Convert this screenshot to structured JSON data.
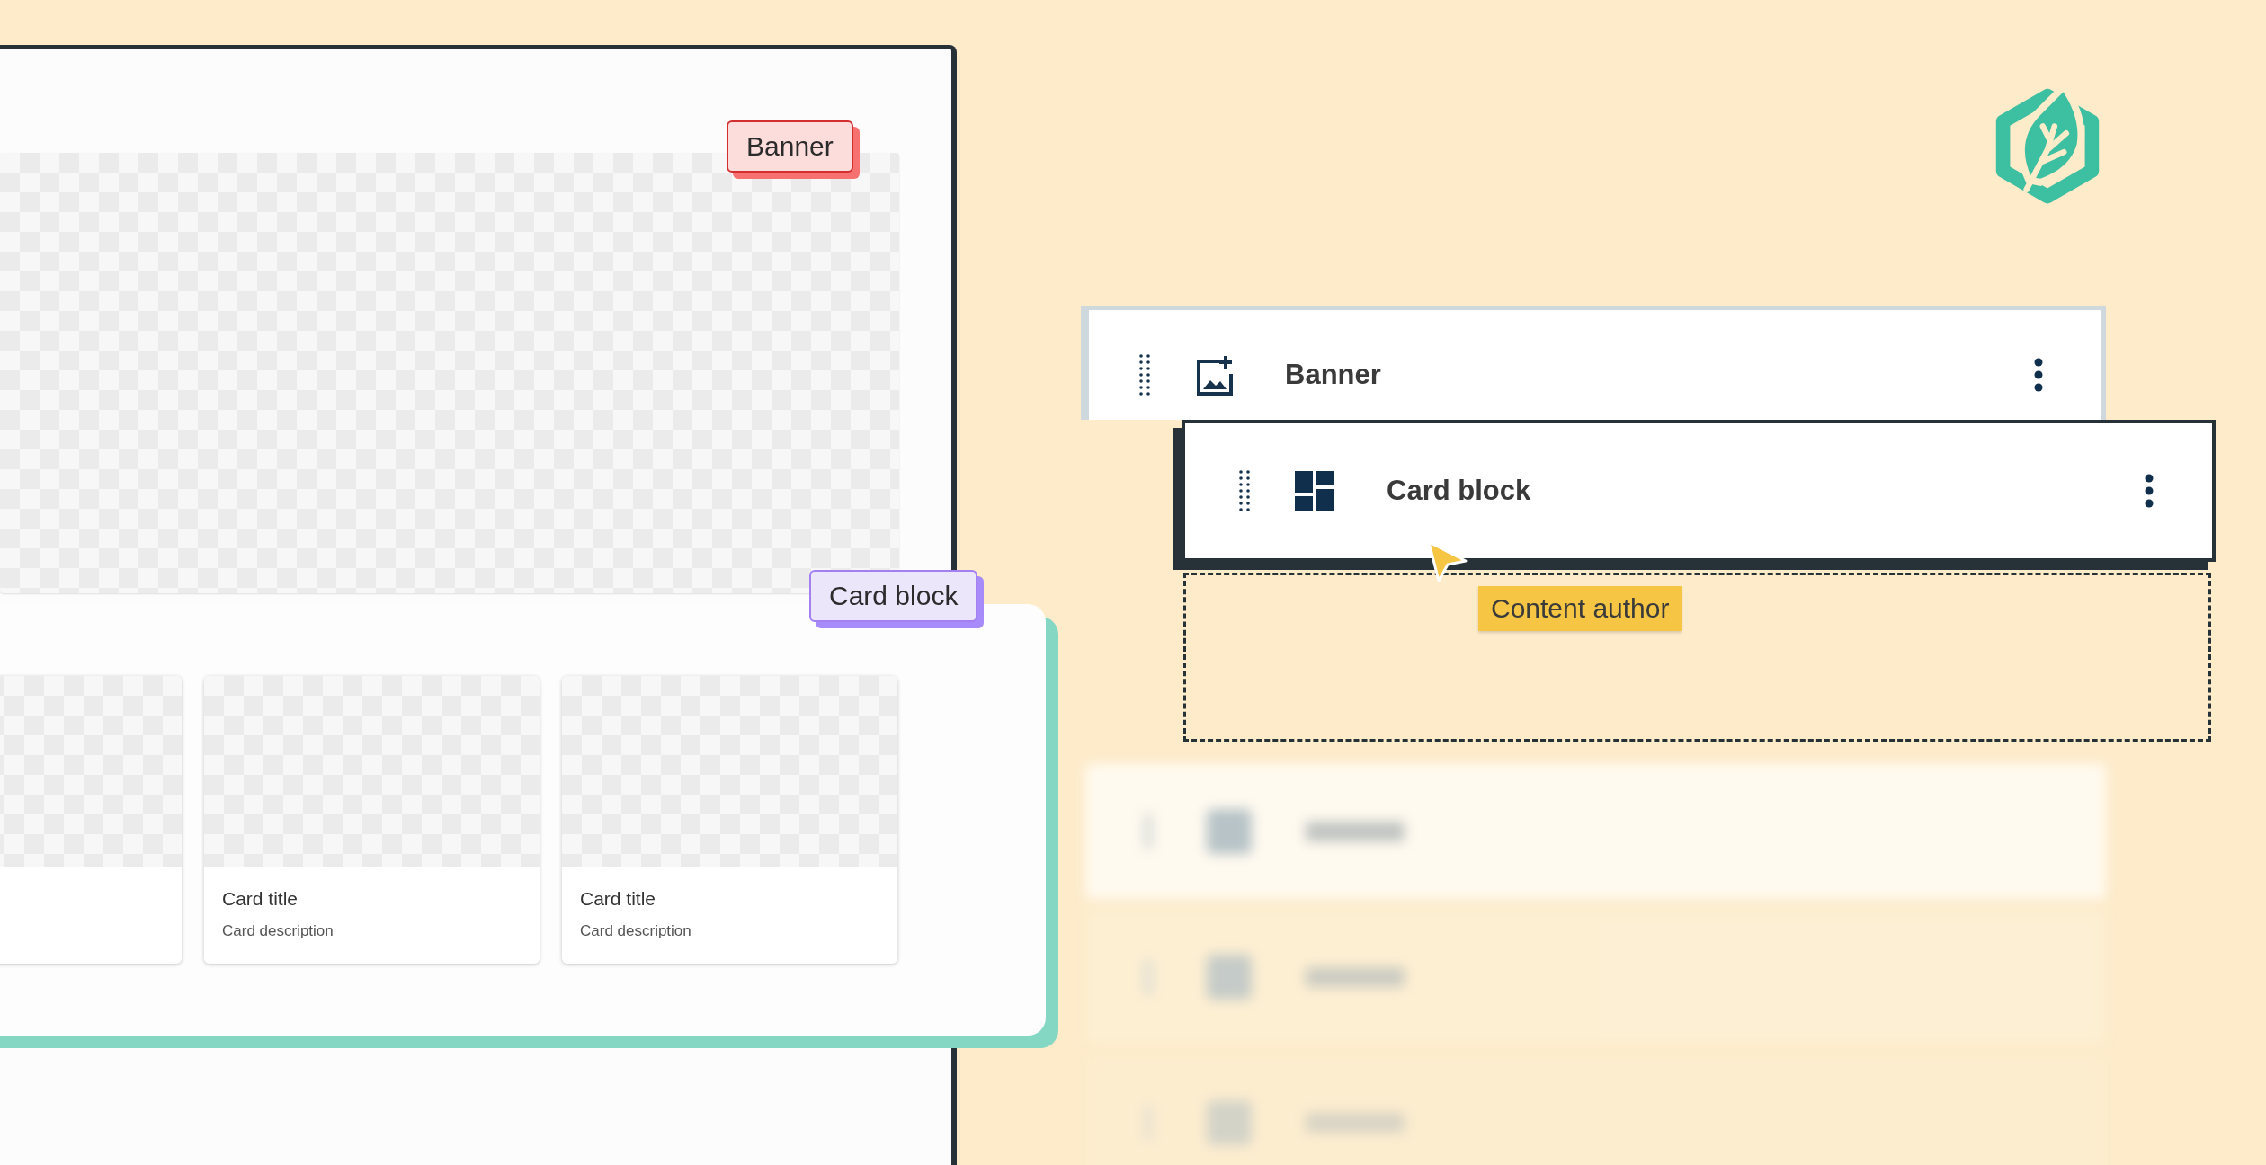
{
  "preview": {
    "banner_tag": "Banner",
    "card_block_tag": "Card block",
    "leading_card_clipped": true,
    "cards": [
      {
        "title": "Card title",
        "description": "Card description"
      },
      {
        "title": "Card title",
        "description": "Card description"
      }
    ]
  },
  "blocks": [
    {
      "label": "Banner",
      "kind": "image",
      "dragging": false
    },
    {
      "label": "Card block",
      "kind": "layout",
      "dragging": true
    }
  ],
  "drop_placeholder": true,
  "cursor_label": "Content author"
}
